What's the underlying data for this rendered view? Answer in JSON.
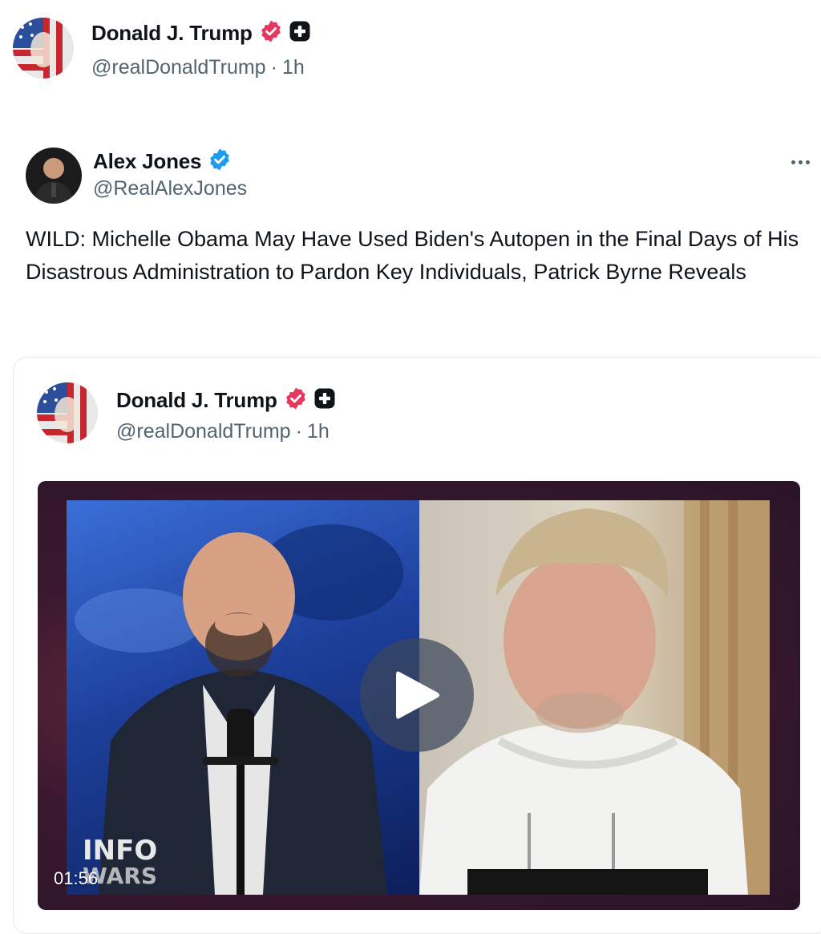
{
  "top_post": {
    "author_name": "Donald J. Trump",
    "handle": "@realDonaldTrump",
    "separator": "·",
    "time": "1h",
    "avatar_icon": "flag-portrait-avatar",
    "verified_color": "#e0245e"
  },
  "quoted_post": {
    "author_name": "Alex Jones",
    "handle": "@RealAlexJones",
    "verified_color": "#1d9bf0",
    "text": "WILD: Michelle Obama May Have Used Biden's Autopen in the Final Days of His Disastrous Administration to Pardon Key Individuals, Patrick Byrne Reveals"
  },
  "embedded_card": {
    "author_name": "Donald J. Trump",
    "handle": "@realDonaldTrump",
    "separator": "·",
    "time": "1h",
    "video": {
      "duration": "01:56",
      "watermark": "INFO WARS"
    }
  }
}
